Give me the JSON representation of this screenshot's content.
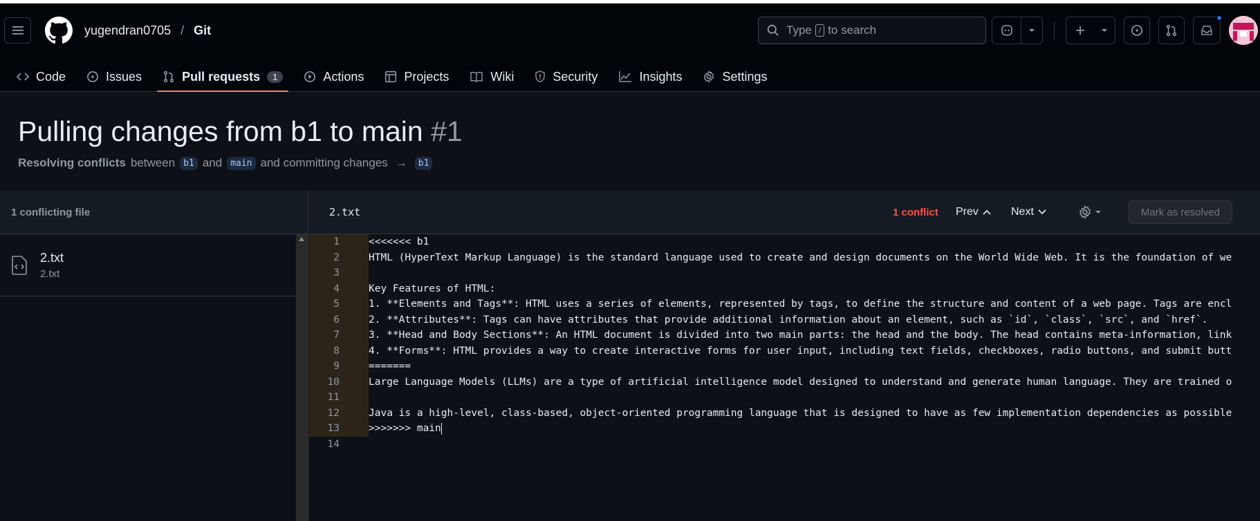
{
  "header": {
    "owner": "yugendran0705",
    "separator": "/",
    "repo": "Git",
    "search": {
      "prefix": "Type",
      "key": "/",
      "suffix": "to search"
    }
  },
  "tabs": [
    {
      "label": "Code"
    },
    {
      "label": "Issues"
    },
    {
      "label": "Pull requests",
      "count": "1"
    },
    {
      "label": "Actions"
    },
    {
      "label": "Projects"
    },
    {
      "label": "Wiki"
    },
    {
      "label": "Security"
    },
    {
      "label": "Insights"
    },
    {
      "label": "Settings"
    }
  ],
  "pr": {
    "title": "Pulling changes from b1 to main",
    "number": "#1",
    "subtitle_bold": "Resolving conflicts",
    "subtitle_between": "between",
    "branch_from": "b1",
    "subtitle_and": "and",
    "branch_to": "main",
    "subtitle_tail": "and committing changes",
    "arrow": "→",
    "target_branch": "b1"
  },
  "sidebar": {
    "heading": "1 conflicting file",
    "files": [
      {
        "name": "2.txt",
        "path": "2.txt"
      }
    ]
  },
  "editor": {
    "filename": "2.txt",
    "conflict_count": "1 conflict",
    "prev_label": "Prev",
    "next_label": "Next",
    "mark_resolved_label": "Mark as resolved",
    "lines": [
      {
        "n": "1",
        "text": "<<<<<<< b1"
      },
      {
        "n": "2",
        "text": "HTML (HyperText Markup Language) is the standard language used to create and design documents on the World Wide Web. It is the foundation of we"
      },
      {
        "n": "3",
        "text": ""
      },
      {
        "n": "4",
        "text": "Key Features of HTML:"
      },
      {
        "n": "5",
        "text": "1. **Elements and Tags**: HTML uses a series of elements, represented by tags, to define the structure and content of a web page. Tags are encl"
      },
      {
        "n": "6",
        "text": "2. **Attributes**: Tags can have attributes that provide additional information about an element, such as `id`, `class`, `src`, and `href`."
      },
      {
        "n": "7",
        "text": "3. **Head and Body Sections**: An HTML document is divided into two main parts: the head and the body. The head contains meta-information, link"
      },
      {
        "n": "8",
        "text": "4. **Forms**: HTML provides a way to create interactive forms for user input, including text fields, checkboxes, radio buttons, and submit butt"
      },
      {
        "n": "9",
        "text": "======="
      },
      {
        "n": "10",
        "text": "Large Language Models (LLMs) are a type of artificial intelligence model designed to understand and generate human language. They are trained o"
      },
      {
        "n": "11",
        "text": ""
      },
      {
        "n": "12",
        "text": "Java is a high-level, class-based, object-oriented programming language that is designed to have as few implementation dependencies as possible"
      },
      {
        "n": "13",
        "text": ">>>>>>> main"
      },
      {
        "n": "14",
        "text": ""
      }
    ]
  },
  "colors": {
    "accent_underline": "#f78166",
    "conflict_red": "#f85149",
    "notification_blue": "#1f6feb",
    "conflict_gutter": "#2d2419"
  }
}
